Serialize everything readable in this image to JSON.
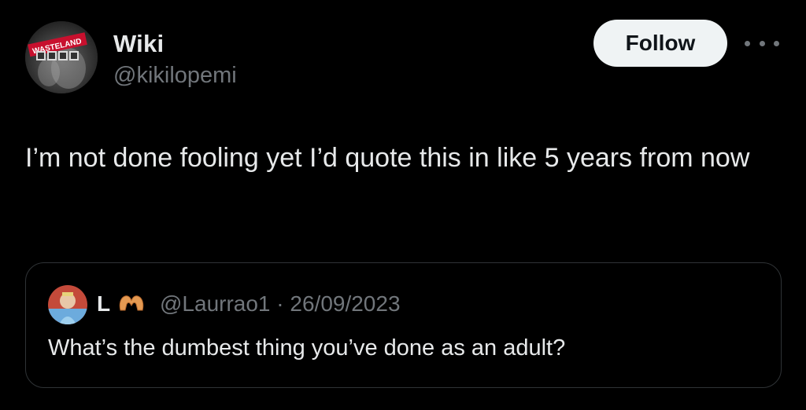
{
  "author": {
    "display_name": "Wiki",
    "handle": "@kikilopemi",
    "avatar_banner_text": "WASTELAND",
    "avatar_icon": "user-avatar"
  },
  "actions": {
    "follow_label": "Follow",
    "more_icon": "more-horizontal-icon"
  },
  "tweet": {
    "text": "I’m not done fooling yet I’d quote this in like 5 years from now"
  },
  "quoted_tweet": {
    "display_name": "L",
    "name_emoji": "heart-hands-emoji",
    "handle": "@Laurrao1",
    "separator": "·",
    "date": "26/09/2023",
    "meta": "@Laurrao1 · 26/09/2023",
    "text": "What’s the dumbest thing you’ve done as an adult?"
  },
  "colors": {
    "background": "#000000",
    "primary_text": "#e7e9ea",
    "secondary_text": "#71767b",
    "follow_button_bg": "#eff3f4",
    "follow_button_text": "#0f1419",
    "quote_border": "#2f3336"
  }
}
